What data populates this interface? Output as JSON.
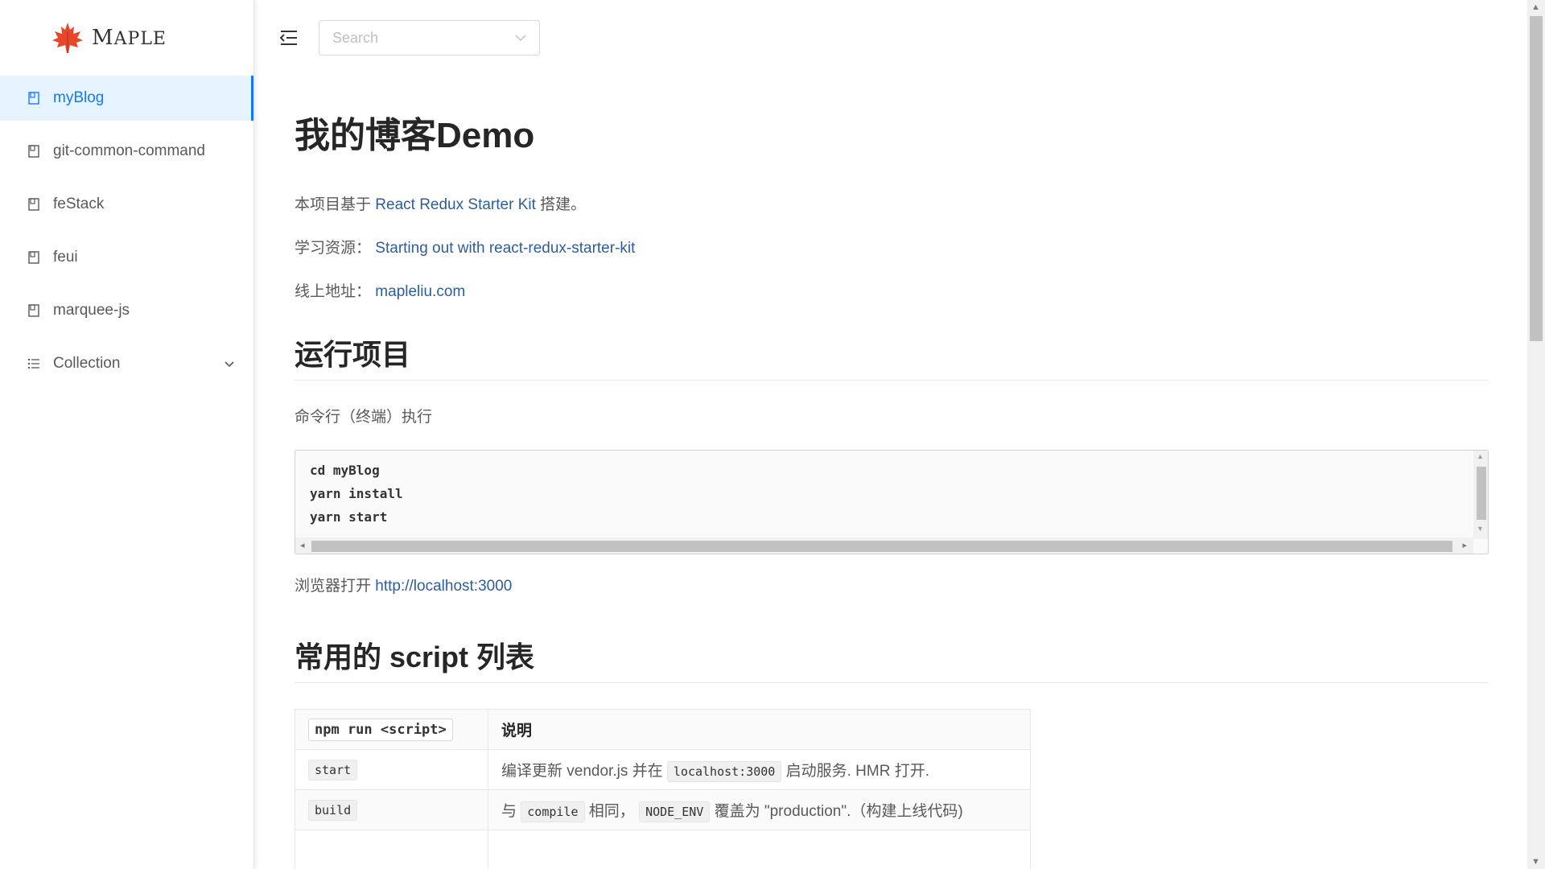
{
  "sidebar": {
    "logo_text": "MAPLE",
    "logo_first": "M",
    "logo_rest": "APLE",
    "items": [
      {
        "label": "myBlog",
        "icon": "book-icon",
        "active": true
      },
      {
        "label": "git-common-command",
        "icon": "book-icon"
      },
      {
        "label": "feStack",
        "icon": "book-icon"
      },
      {
        "label": "feui",
        "icon": "book-icon"
      },
      {
        "label": "marquee-js",
        "icon": "book-icon"
      },
      {
        "label": "Collection",
        "icon": "list-icon",
        "expandable": true
      }
    ]
  },
  "header": {
    "search_placeholder": "Search"
  },
  "article": {
    "title": "我的博客Demo",
    "intro_prefix": "本项目基于 ",
    "intro_link": "React Redux Starter Kit",
    "intro_suffix": " 搭建。",
    "resource_label": "学习资源：",
    "resource_link": "Starting out with react-redux-starter-kit",
    "online_label": "线上地址：",
    "online_link": "mapleliu.com",
    "run_heading": "运行项目",
    "run_desc": "命令行（终端）执行",
    "code": "cd myBlog\nyarn install\nyarn start",
    "browser_prefix": "浏览器打开 ",
    "browser_link": "http://localhost:3000",
    "script_heading": "常用的 script 列表",
    "table": {
      "header": {
        "col1": "npm run <script>",
        "col2": "说明"
      },
      "rows": [
        {
          "cmd": "start",
          "desc_a": "编译更新 vendor.js 并在 ",
          "desc_code": "localhost:3000",
          "desc_b": " 启动服务. HMR 打开."
        },
        {
          "cmd": "build",
          "desc_a": "与 ",
          "desc_code": "compile",
          "desc_mid": " 相同， ",
          "desc_code2": "NODE_ENV",
          "desc_b": " 覆盖为 \"production\".（构建上线代码)"
        }
      ]
    }
  },
  "colors": {
    "accent": "#1677ff",
    "link": "#2d5d9b",
    "active_bg": "#e6f4ff",
    "logo_leaf": "#e8472b"
  }
}
